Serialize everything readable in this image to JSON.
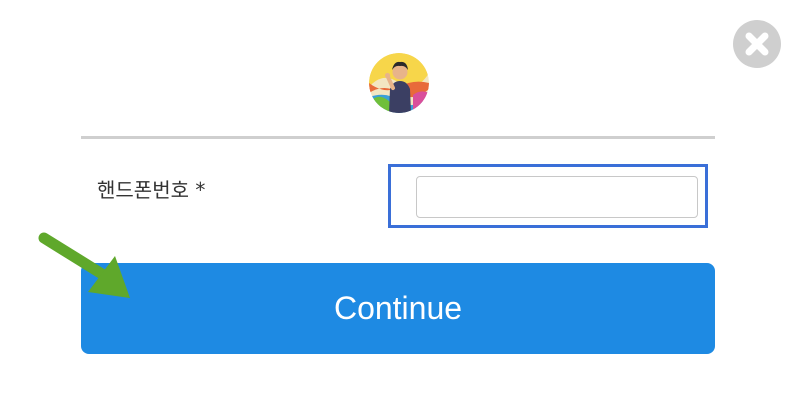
{
  "modal": {
    "field_label": "핸드폰번호 *",
    "phone_value": "",
    "continue_label": "Continue"
  },
  "icons": {
    "close": "close-icon",
    "avatar": "avatar",
    "annotation_arrow": "green-arrow-icon"
  },
  "colors": {
    "button": "#1e8ae3",
    "highlight_border": "#3a6fd8",
    "arrow": "#5fa82b",
    "close": "#cfcfcf",
    "divider": "#cfcfcf"
  }
}
